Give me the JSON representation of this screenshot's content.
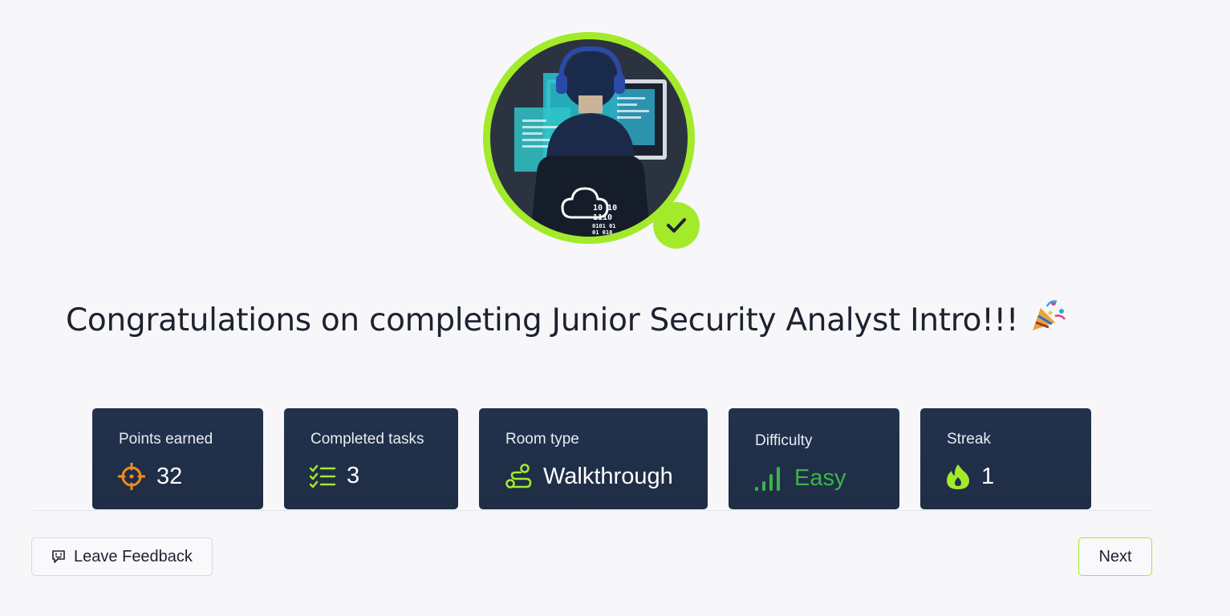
{
  "title": {
    "text": "Congratulations on completing Junior Security Analyst Intro!!!",
    "emoji": "party-popper"
  },
  "badge": {
    "binary_lines": [
      "10  10",
      "1110",
      "0101  01",
      "01   010",
      "01"
    ],
    "completed_check": "check-icon"
  },
  "stats": [
    {
      "label": "Points earned",
      "value": "32",
      "icon": "target-icon",
      "icon_color": "#f08c1b"
    },
    {
      "label": "Completed tasks",
      "value": "3",
      "icon": "checklist-icon",
      "icon_color": "#a3ea2a"
    },
    {
      "label": "Room type",
      "value": "Walkthrough",
      "icon": "route-icon",
      "icon_color": "#a3ea2a"
    },
    {
      "label": "Difficulty",
      "value": "Easy",
      "icon": "signal-bars-icon",
      "icon_color": "#3cb34a"
    },
    {
      "label": "Streak",
      "value": "1",
      "icon": "flame-icon",
      "icon_color": "#a3ea2a"
    }
  ],
  "footer": {
    "feedback_label": "Leave Feedback",
    "next_label": "Next"
  },
  "colors": {
    "accent": "#a3ea2a",
    "card_bg": "#22324d",
    "page_bg": "#f7f7f9",
    "text_dark": "#1c2230"
  }
}
